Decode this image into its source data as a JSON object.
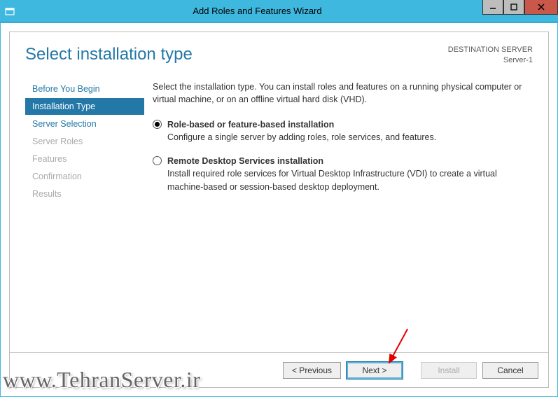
{
  "window": {
    "title": "Add Roles and Features Wizard"
  },
  "header": {
    "page_title": "Select installation type",
    "dest_label": "DESTINATION SERVER",
    "dest_value": "Server-1"
  },
  "sidebar": {
    "items": [
      {
        "label": "Before You Begin",
        "state": "enabled"
      },
      {
        "label": "Installation Type",
        "state": "active"
      },
      {
        "label": "Server Selection",
        "state": "enabled"
      },
      {
        "label": "Server Roles",
        "state": "disabled"
      },
      {
        "label": "Features",
        "state": "disabled"
      },
      {
        "label": "Confirmation",
        "state": "disabled"
      },
      {
        "label": "Results",
        "state": "disabled"
      }
    ]
  },
  "content": {
    "intro": "Select the installation type. You can install roles and features on a running physical computer or virtual machine, or on an offline virtual hard disk (VHD).",
    "options": [
      {
        "label": "Role-based or feature-based installation",
        "desc": "Configure a single server by adding roles, role services, and features.",
        "selected": true
      },
      {
        "label": "Remote Desktop Services installation",
        "desc": "Install required role services for Virtual Desktop Infrastructure (VDI) to create a virtual machine-based or session-based desktop deployment.",
        "selected": false
      }
    ]
  },
  "footer": {
    "previous": "< Previous",
    "next": "Next >",
    "install": "Install",
    "cancel": "Cancel"
  },
  "watermark": "www.TehranServer.ir"
}
